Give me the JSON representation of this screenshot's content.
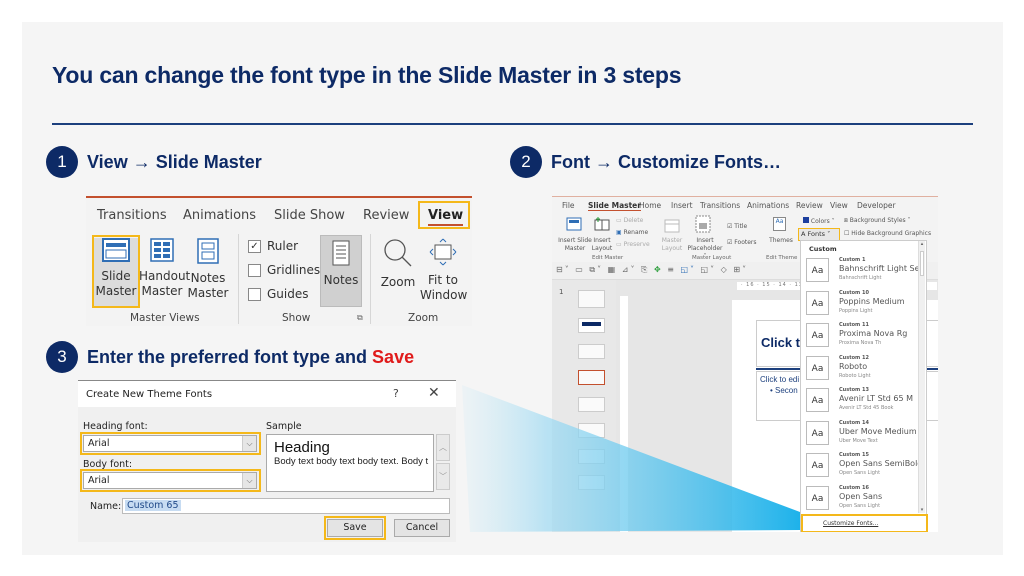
{
  "slide": {
    "title": "You can change the font type in the Slide Master in 3 steps",
    "colors": {
      "navy": "#0d2a66",
      "highlight": "#f4b81a",
      "save_red": "#e01b1b",
      "accent_blue": "#1aa9e8"
    }
  },
  "steps": [
    {
      "number": "1",
      "text": "View → Slide Master"
    },
    {
      "number": "2",
      "text": "Font → Customize Fonts…"
    },
    {
      "number": "3",
      "text_prefix": "Enter the preferred font type and ",
      "text_highlight": "Save"
    }
  ],
  "ribbon": {
    "tabs": [
      "Transitions",
      "Animations",
      "Slide Show",
      "Review",
      "View"
    ],
    "active_tab": "View",
    "buttons": {
      "slide_master": [
        "Slide",
        "Master"
      ],
      "handout_master": [
        "Handout",
        "Master"
      ],
      "notes_master": [
        "Notes",
        "Master"
      ],
      "notes": "Notes",
      "zoom": "Zoom",
      "fit_to_window": [
        "Fit to",
        "Window"
      ]
    },
    "checkboxes": [
      {
        "label": "Ruler",
        "checked": true
      },
      {
        "label": "Gridlines",
        "checked": false
      },
      {
        "label": "Guides",
        "checked": false
      }
    ],
    "groups": [
      "Master Views",
      "Show",
      "Zoom"
    ]
  },
  "dialog": {
    "title": "Create New Theme Fonts",
    "help": "?",
    "close": "✕",
    "heading_font_label": "Heading font:",
    "heading_font_value": "Arial",
    "body_font_label": "Body font:",
    "body_font_value": "Arial",
    "sample_label": "Sample",
    "sample_heading": "Heading",
    "sample_body": "Body text body text body text. Body t",
    "name_label": "Name:",
    "name_value": "Custom 65",
    "save_label": "Save",
    "cancel_label": "Cancel"
  },
  "ppt": {
    "tabs": [
      "File",
      "Slide Master",
      "Home",
      "Insert",
      "Transitions",
      "Animations",
      "Review",
      "View",
      "Developer"
    ],
    "active_tab": "Slide Master",
    "edit_master": {
      "insert_slide_master": [
        "Insert Slide",
        "Master"
      ],
      "insert_layout": [
        "Insert",
        "Layout"
      ],
      "delete": "Delete",
      "rename": "Rename",
      "preserve": "Preserve",
      "group": "Edit Master"
    },
    "master_layout": {
      "master_layout": [
        "Master",
        "Layout"
      ],
      "insert_placeholder": [
        "Insert",
        "Placeholder ˅"
      ],
      "title": "Title",
      "footers": "Footers",
      "group": "Master Layout"
    },
    "edit_theme": {
      "themes": "Themes",
      "group": "Edit Theme"
    },
    "background": {
      "colors": "Colors ˅",
      "fonts": "Fonts ˅",
      "background_styles": "Background Styles ˅",
      "hide_bg_graphics": "Hide Background Graphics"
    },
    "ruler_text": "· 16 · 15 · 14 · 13",
    "slide_number": "1",
    "canvas_title": "Click to",
    "canvas_body_1": "Click to edi",
    "canvas_body_2": "•  Secon",
    "font_menu": {
      "header": "Custom",
      "items": [
        {
          "name": "Custom 1",
          "heading": "Bahnschrift Light Sem",
          "body": "Bahnschrift Light"
        },
        {
          "name": "Custom 10",
          "heading": "Poppins Medium",
          "body": "Poppins Light"
        },
        {
          "name": "Custom 11",
          "heading": "Proxima Nova Rg",
          "body": "Proxima Nova Th"
        },
        {
          "name": "Custom 12",
          "heading": "Roboto",
          "body": "Roboto Light"
        },
        {
          "name": "Custom 13",
          "heading": "Avenir LT Std 65 M",
          "body": "Avenir LT Std 45 Book"
        },
        {
          "name": "Custom 14",
          "heading": "Uber Move Medium",
          "body": "Uber Move Text"
        },
        {
          "name": "Custom 15",
          "heading": "Open Sans SemiBold",
          "body": "Open Sans Light"
        },
        {
          "name": "Custom 16",
          "heading": "Open Sans",
          "body": "Open Sans Light"
        }
      ],
      "preview_glyph": "Aa",
      "customize_label": "Customize Fonts..."
    }
  }
}
